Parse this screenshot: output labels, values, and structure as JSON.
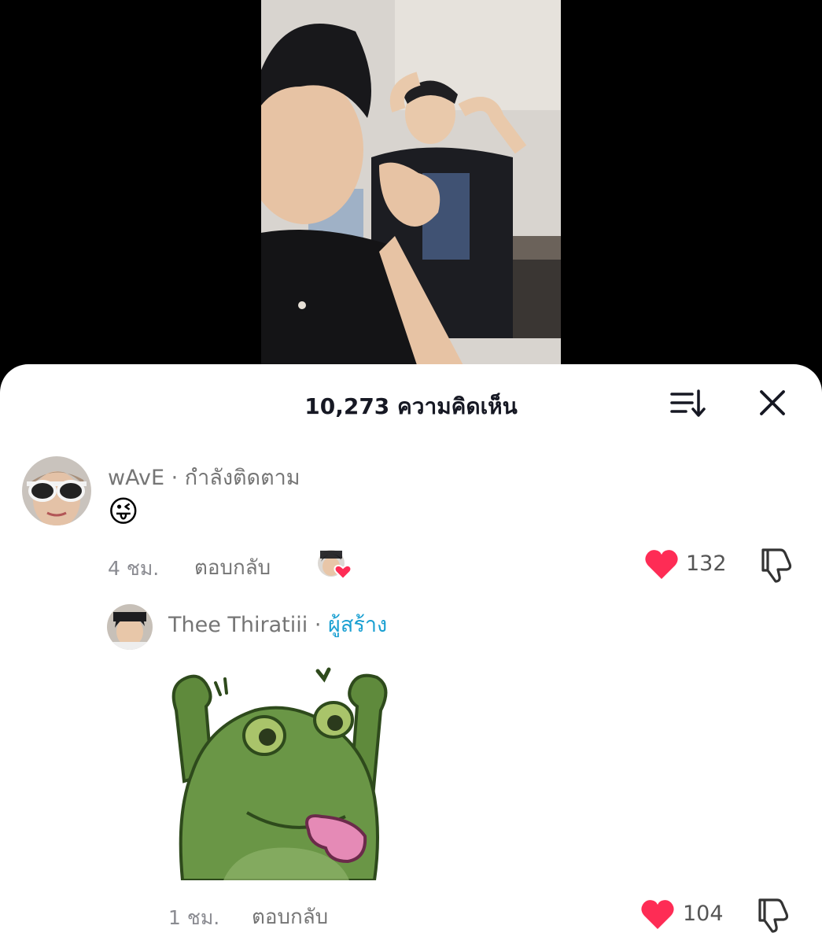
{
  "header": {
    "title": "10,273 ความคิดเห็น"
  },
  "comments": [
    {
      "username": "wAvE",
      "separator": " · ",
      "status": "กำลังติดตาม",
      "content": "😜",
      "time": "4 ชม.",
      "reply_label": "ตอบกลับ",
      "like_count": "132"
    }
  ],
  "replies": [
    {
      "username": "Thee Thiratiii",
      "separator": " · ",
      "badge": "ผู้สร้าง",
      "sticker": "frog-sticker",
      "time": "1 ชม.",
      "reply_label": "ตอบกลับ",
      "like_count": "104"
    }
  ],
  "colors": {
    "heart": "#fe2c55",
    "creator": "#1ba0d2",
    "text_secondary": "#8a8b91"
  },
  "icons": [
    "sort-icon",
    "close-icon",
    "heart-icon",
    "dislike-icon",
    "creator-liked-icon"
  ]
}
